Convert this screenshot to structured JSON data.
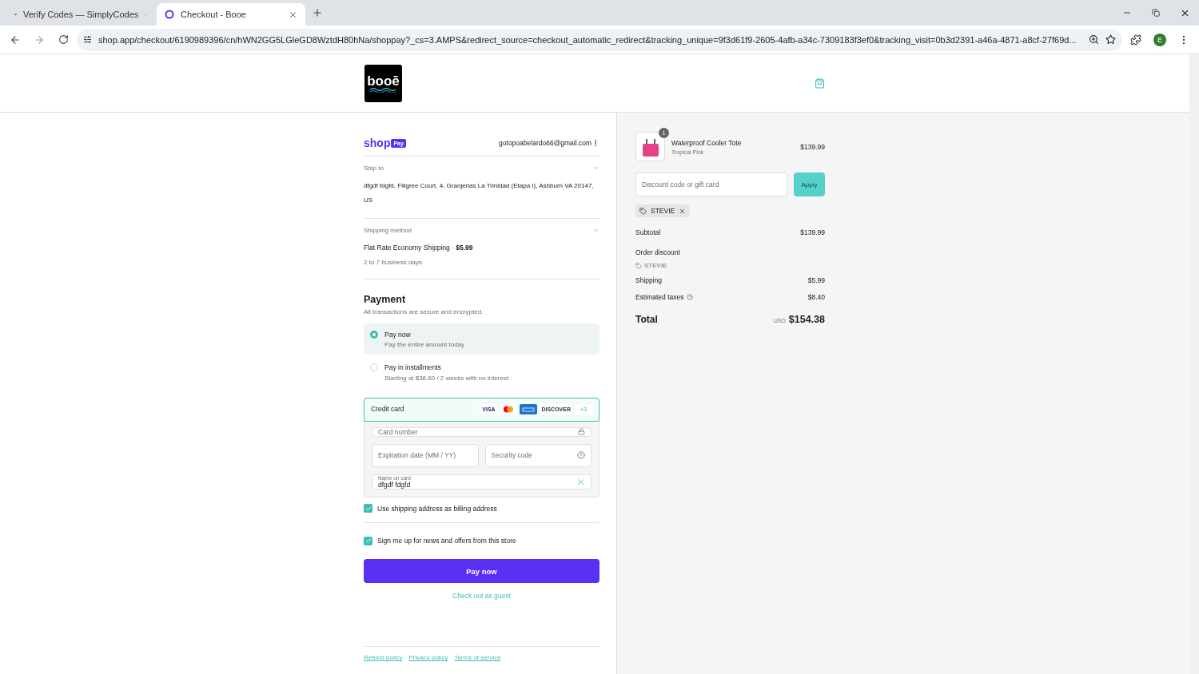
{
  "browser": {
    "tabs": [
      {
        "title": "Verify Codes — SimplyCodes",
        "selected": false,
        "kind": "simplycodes"
      },
      {
        "title": "Checkout - Booe",
        "selected": true,
        "kind": "shop"
      }
    ],
    "url": "shop.app/checkout/6190989396/cn/hWN2GG5LGleGD8WztdH80hNa/shoppay?_cs=3.AMPS&redirect_source=checkout_automatic_redirect&tracking_unique=9f3d61f9-2605-4afb-a34c-7309183f3ef0&tracking_visit=0b3d2391-a46a-4871-a8cf-27f69d...",
    "profile_initial": "E"
  },
  "store": {
    "logo": "booē"
  },
  "account": {
    "brand": "shop",
    "badge": "Pay",
    "email": "gotopoabelardo66@gmail.com"
  },
  "ship_to": {
    "label": "Ship to",
    "value": "dfgdf fdgfd, Filigree Court, 4, Granjerias La Trinidad (Etapa I), Ashburn VA 20147, US"
  },
  "shipping_method": {
    "label": "Shipping method",
    "name": "Flat Rate Economy Shipping ·",
    "price": "$5.99",
    "note": "2 to 7 business days"
  },
  "payment": {
    "title": "Payment",
    "subtitle": "All transactions are secure and encrypted.",
    "options": [
      {
        "label": "Pay now",
        "detail": "Pay the entire amount today",
        "selected": true
      },
      {
        "label": "Pay in installments",
        "detail": "Starting at $38.60 / 2 weeks with no interest",
        "selected": false
      }
    ],
    "credit_card": {
      "label": "Credit card",
      "brands": [
        {
          "kind": "visa",
          "label": "VISA"
        },
        {
          "kind": "mastercard"
        },
        {
          "kind": "amex"
        },
        {
          "kind": "discover",
          "label": "DISCOVER"
        }
      ],
      "more": "+3",
      "card_number": {
        "placeholder": "Card number"
      },
      "expiration": {
        "placeholder": "Expiration date (MM / YY)"
      },
      "security_code": {
        "placeholder": "Security code"
      },
      "name_on_card": {
        "label": "Name on card",
        "value": "dfgdf fdgfd"
      }
    }
  },
  "checkboxes": [
    {
      "label": "Use shipping address as billing address",
      "checked": true
    },
    {
      "label": "Sign me up for news and offers from this store",
      "checked": true
    }
  ],
  "pay_button": "Pay now",
  "guest_link": "Check out as guest",
  "footer_links": [
    "Refund policy",
    "Privacy policy",
    "Terms of service"
  ],
  "summary": {
    "item": {
      "name": "Waterproof Cooler Tote",
      "variant": "Tropical Pink",
      "price": "$139.99",
      "quantity": "1"
    },
    "discount": {
      "placeholder": "Discount code or gift card",
      "button": "Apply"
    },
    "applied_code": "STEVIE",
    "lines": [
      {
        "kind": "amount",
        "label": "Subtotal",
        "value": "$139.99"
      },
      {
        "kind": "code",
        "label": "Order discount",
        "code": "STEVIE"
      },
      {
        "kind": "amount",
        "label": "Shipping",
        "value": "$5.99"
      },
      {
        "kind": "info",
        "label": "Estimated taxes",
        "value": "$8.40"
      }
    ],
    "total": {
      "label": "Total",
      "currency": "USD",
      "amount": "$154.38"
    }
  }
}
